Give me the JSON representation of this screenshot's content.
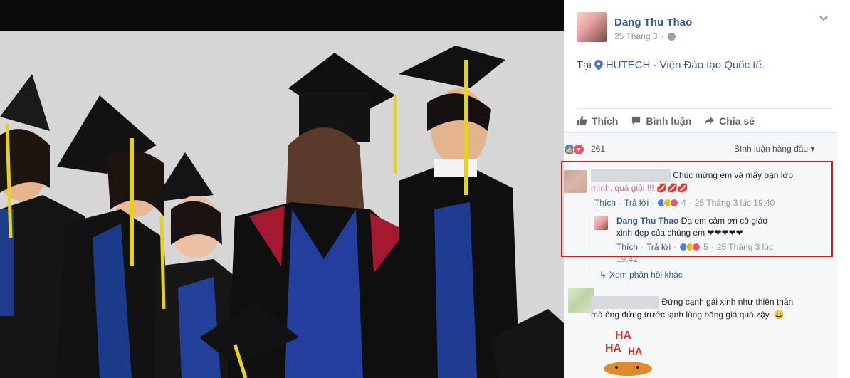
{
  "post": {
    "author": "Dang Thu Thao",
    "date": "25 Tháng 3",
    "location_prefix": "Tại",
    "location": "HUTECH - Viện Đào tạo Quốc tế."
  },
  "actions": {
    "like": "Thích",
    "comment": "Bình luận",
    "share": "Chia sẻ"
  },
  "reactions": {
    "count": "261",
    "sort_label": "Bình luận hàng đầu"
  },
  "comments": [
    {
      "text_line1": "Chúc mừng em và mấy bạn lớp",
      "text_line2": "mình, quá giỏi !!! 💋💋💋",
      "like": "Thích",
      "reply": "Trả lời",
      "reaction_count": "4",
      "time": "25 Tháng 3 lúc 19:40",
      "reply_item": {
        "author": "Dang Thu Thao",
        "text_line1": "Dạ em cảm ơn cô giáo",
        "text_line2": "xinh đẹp của chúng em ❤❤❤❤❤",
        "like": "Thích",
        "reply": "Trả lời",
        "reaction_count": "5",
        "time": "25 Tháng 3 lúc",
        "time_line2": "19:42"
      },
      "more_replies": "Xem phản hồi khác"
    },
    {
      "text_line1": "Đứng cạnh gái xinh như thiên thần",
      "text_line2": "mà ông đứng trước lạnh lùng băng giá quá zậy. 😀",
      "sticker_text": "HA HA HA"
    }
  ],
  "colors": {
    "link": "#365899",
    "highlight": "#d6171b",
    "panel_bg": "#f6f7f9"
  }
}
